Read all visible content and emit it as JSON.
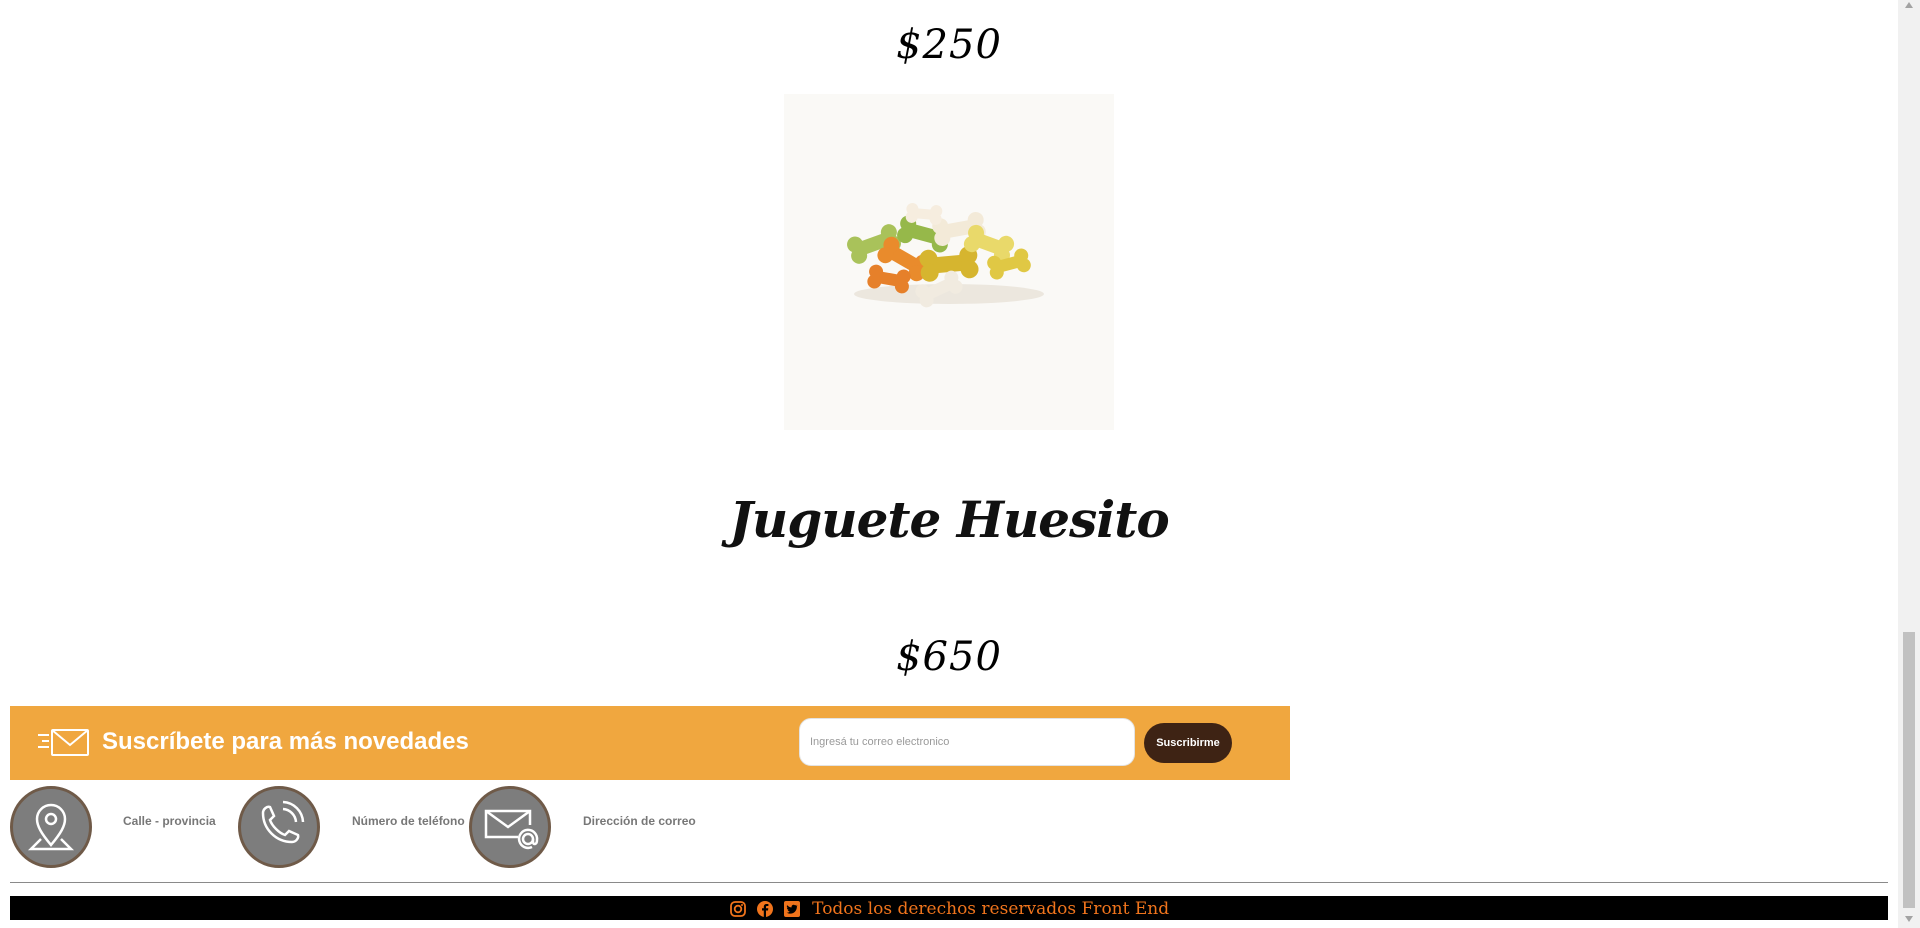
{
  "product_prev": {
    "price": "$250"
  },
  "product": {
    "name": "Juguete Huesito",
    "price": "$650",
    "image_icon": "dog-biscuit-treats-image"
  },
  "newsletter": {
    "title": "Suscríbete para más novedades",
    "icon": "mail-send-icon",
    "email_placeholder": "Ingresá tu correo electronico",
    "email_value": "",
    "button_label": "Suscribirme"
  },
  "contact": {
    "items": [
      {
        "icon": "location-pin-icon",
        "label": "Calle - provincia"
      },
      {
        "icon": "phone-icon",
        "label": "Número de teléfono"
      },
      {
        "icon": "email-at-icon",
        "label": "Dirección de correo"
      }
    ]
  },
  "footer": {
    "icons": [
      "instagram-icon",
      "facebook-icon",
      "twitter-icon"
    ],
    "text": "Todos los derechos reservados Front End"
  },
  "colors": {
    "accent_orange": "#f0a73f",
    "button_brown": "#3e2314",
    "footer_text": "#f0741c",
    "contact_circle": "#7d7d7d"
  }
}
